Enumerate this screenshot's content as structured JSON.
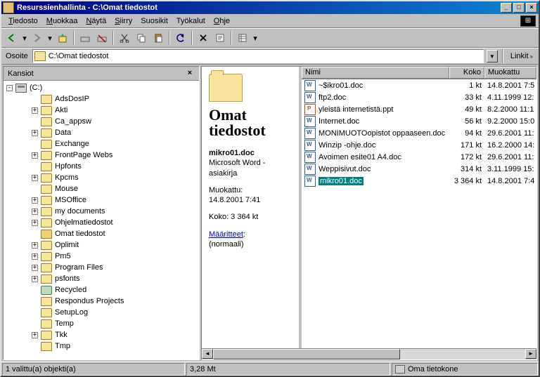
{
  "title": "Resurssienhallinta - C:\\Omat tiedostot",
  "menu": [
    "Tiedosto",
    "Muokkaa",
    "Näytä",
    "Siirry",
    "Suosikit",
    "Työkalut",
    "Ohje"
  ],
  "addr": {
    "label": "Osoite",
    "value": "C:\\Omat tiedostot",
    "links": "Linkit"
  },
  "left": {
    "header": "Kansiot"
  },
  "tree": {
    "root": "(C:)",
    "items": [
      {
        "exp": "",
        "name": "AdsDosIP",
        "ind": 1
      },
      {
        "exp": "+",
        "name": "Akti",
        "ind": 1
      },
      {
        "exp": "",
        "name": "Ca_appsw",
        "ind": 1
      },
      {
        "exp": "+",
        "name": "Data",
        "ind": 1
      },
      {
        "exp": "",
        "name": "Exchange",
        "ind": 1
      },
      {
        "exp": "+",
        "name": "FrontPage Webs",
        "ind": 1
      },
      {
        "exp": "",
        "name": "Hpfonts",
        "ind": 1
      },
      {
        "exp": "+",
        "name": "Kpcms",
        "ind": 1
      },
      {
        "exp": "",
        "name": "Mouse",
        "ind": 1
      },
      {
        "exp": "+",
        "name": "MSOffice",
        "ind": 1
      },
      {
        "exp": "+",
        "name": "my documents",
        "ind": 1
      },
      {
        "exp": "+",
        "name": "Ohjelmatiedostot",
        "ind": 1
      },
      {
        "exp": "",
        "name": "Omat tiedostot",
        "ind": 1,
        "open": true
      },
      {
        "exp": "+",
        "name": "Oplimit",
        "ind": 1
      },
      {
        "exp": "+",
        "name": "Pm5",
        "ind": 1
      },
      {
        "exp": "+",
        "name": "Program Files",
        "ind": 1
      },
      {
        "exp": "+",
        "name": "psfonts",
        "ind": 1
      },
      {
        "exp": "",
        "name": "Recycled",
        "ind": 1,
        "recycle": true
      },
      {
        "exp": "",
        "name": "Respondus Projects",
        "ind": 1
      },
      {
        "exp": "",
        "name": "SetupLog",
        "ind": 1
      },
      {
        "exp": "",
        "name": "Temp",
        "ind": 1
      },
      {
        "exp": "+",
        "name": "Tkk",
        "ind": 1
      },
      {
        "exp": "",
        "name": "Tmp",
        "ind": 1
      }
    ]
  },
  "info": {
    "title1": "Omat",
    "title2": "tiedostot",
    "filename": "mikro01.doc",
    "filetype": "Microsoft Word -asiakirja",
    "mod_label": "Muokattu:",
    "mod_value": "14.8.2001 7:41",
    "size_label": "Koko: 3 364 kt",
    "attr_label": "Määritteet",
    "attr_value": "(normaali)"
  },
  "cols": {
    "name": "Nimi",
    "size": "Koko",
    "mod": "Muokattu"
  },
  "files": [
    {
      "icon": "doc",
      "name": "~$ikro01.doc",
      "size": "1 kt",
      "mod": "14.8.2001 7:5"
    },
    {
      "icon": "doc",
      "name": "ftp2.doc",
      "size": "33 kt",
      "mod": "4.11.1999 12:"
    },
    {
      "icon": "ppt",
      "name": "yleistä internetistä.ppt",
      "size": "49 kt",
      "mod": "8.2.2000 11:1"
    },
    {
      "icon": "doc",
      "name": "Internet.doc",
      "size": "56 kt",
      "mod": "9.2.2000 15:0"
    },
    {
      "icon": "doc",
      "name": "MONIMUOTOopistot oppaaseen.doc",
      "size": "94 kt",
      "mod": "29.6.2001 11:"
    },
    {
      "icon": "doc",
      "name": "Winzip -ohje.doc",
      "size": "171 kt",
      "mod": "16.2.2000 14:"
    },
    {
      "icon": "doc",
      "name": "Avoimen esite01 A4.doc",
      "size": "172 kt",
      "mod": "29.6.2001 11:"
    },
    {
      "icon": "doc",
      "name": "Weppisivut.doc",
      "size": "314 kt",
      "mod": "3.11.1999 15:"
    },
    {
      "icon": "doc",
      "name": "mikro01.doc",
      "size": "3 364 kt",
      "mod": "14.8.2001 7:4",
      "sel": true
    }
  ],
  "status": {
    "sel": "1 valittu(a) objekti(a)",
    "size": "3,28 Mt",
    "loc": "Oma tietokone"
  }
}
